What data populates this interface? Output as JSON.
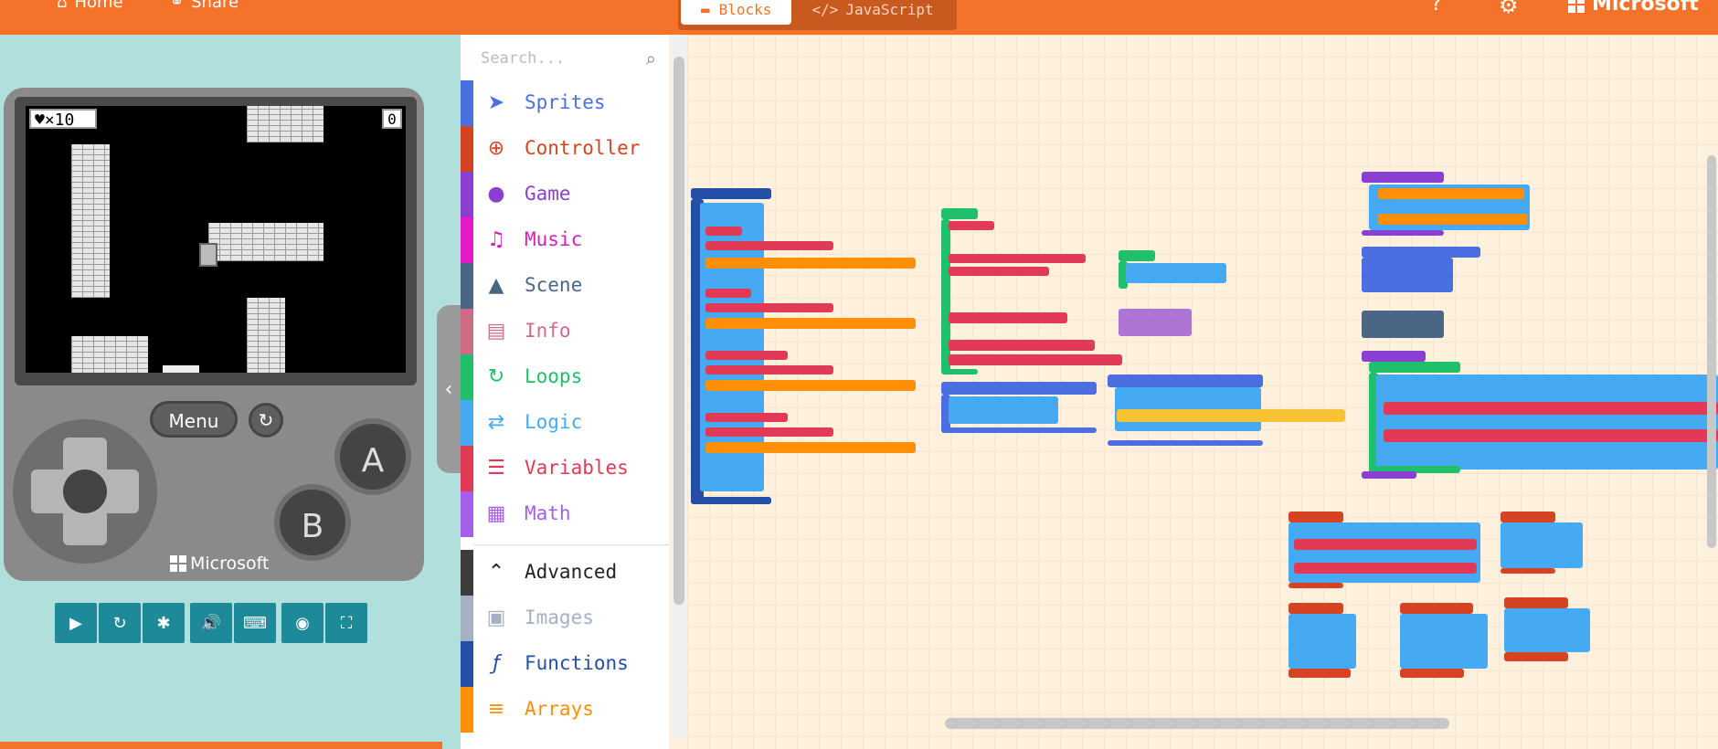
{
  "topbar": {
    "home_label": "Home",
    "share_label": "Share",
    "tab_blocks": "Blocks",
    "tab_js": "JavaScript",
    "brand": "Microsoft"
  },
  "simulator": {
    "lives_text": "×10",
    "score_text": "0",
    "menu_label": "Menu",
    "brand": "Microsoft",
    "button_a": "A",
    "button_b": "B"
  },
  "toolbox": {
    "search_placeholder": "Search...",
    "categories": [
      {
        "label": "Sprites",
        "color": "#4b6fe0",
        "icon": "paper-plane-icon"
      },
      {
        "label": "Controller",
        "color": "#d54322",
        "icon": "gamepad-icon"
      },
      {
        "label": "Game",
        "color": "#8a3fd1",
        "icon": "circle-icon"
      },
      {
        "label": "Music",
        "color": "#e63022",
        "icon": "headphones-icon"
      },
      {
        "label": "Scene",
        "color": "#4b6584",
        "icon": "tree-icon"
      },
      {
        "label": "Info",
        "color": "#cf6a87",
        "icon": "id-card-icon"
      },
      {
        "label": "Loops",
        "color": "#20bf6b",
        "icon": "refresh-icon"
      },
      {
        "label": "Logic",
        "color": "#45aaf2",
        "icon": "shuffle-icon"
      },
      {
        "label": "Variables",
        "color": "#e03a56",
        "icon": "list-icon"
      },
      {
        "label": "Math",
        "color": "#a55eea",
        "icon": "calculator-icon"
      },
      {
        "label": "Advanced",
        "color": "#3c3c3c",
        "icon": "chevron-up-icon"
      },
      {
        "label": "Images",
        "color": "#a5b1c2",
        "icon": "image-icon"
      },
      {
        "label": "Functions",
        "color": "#254ea6",
        "icon": "function-icon"
      },
      {
        "label": "Arrays",
        "color": "#ff8f08",
        "icon": "numbered-list-icon"
      }
    ]
  },
  "colors": {
    "orange": "#f5722a",
    "teal": "#1e8a99",
    "sim_bg": "#b1e0dc"
  }
}
